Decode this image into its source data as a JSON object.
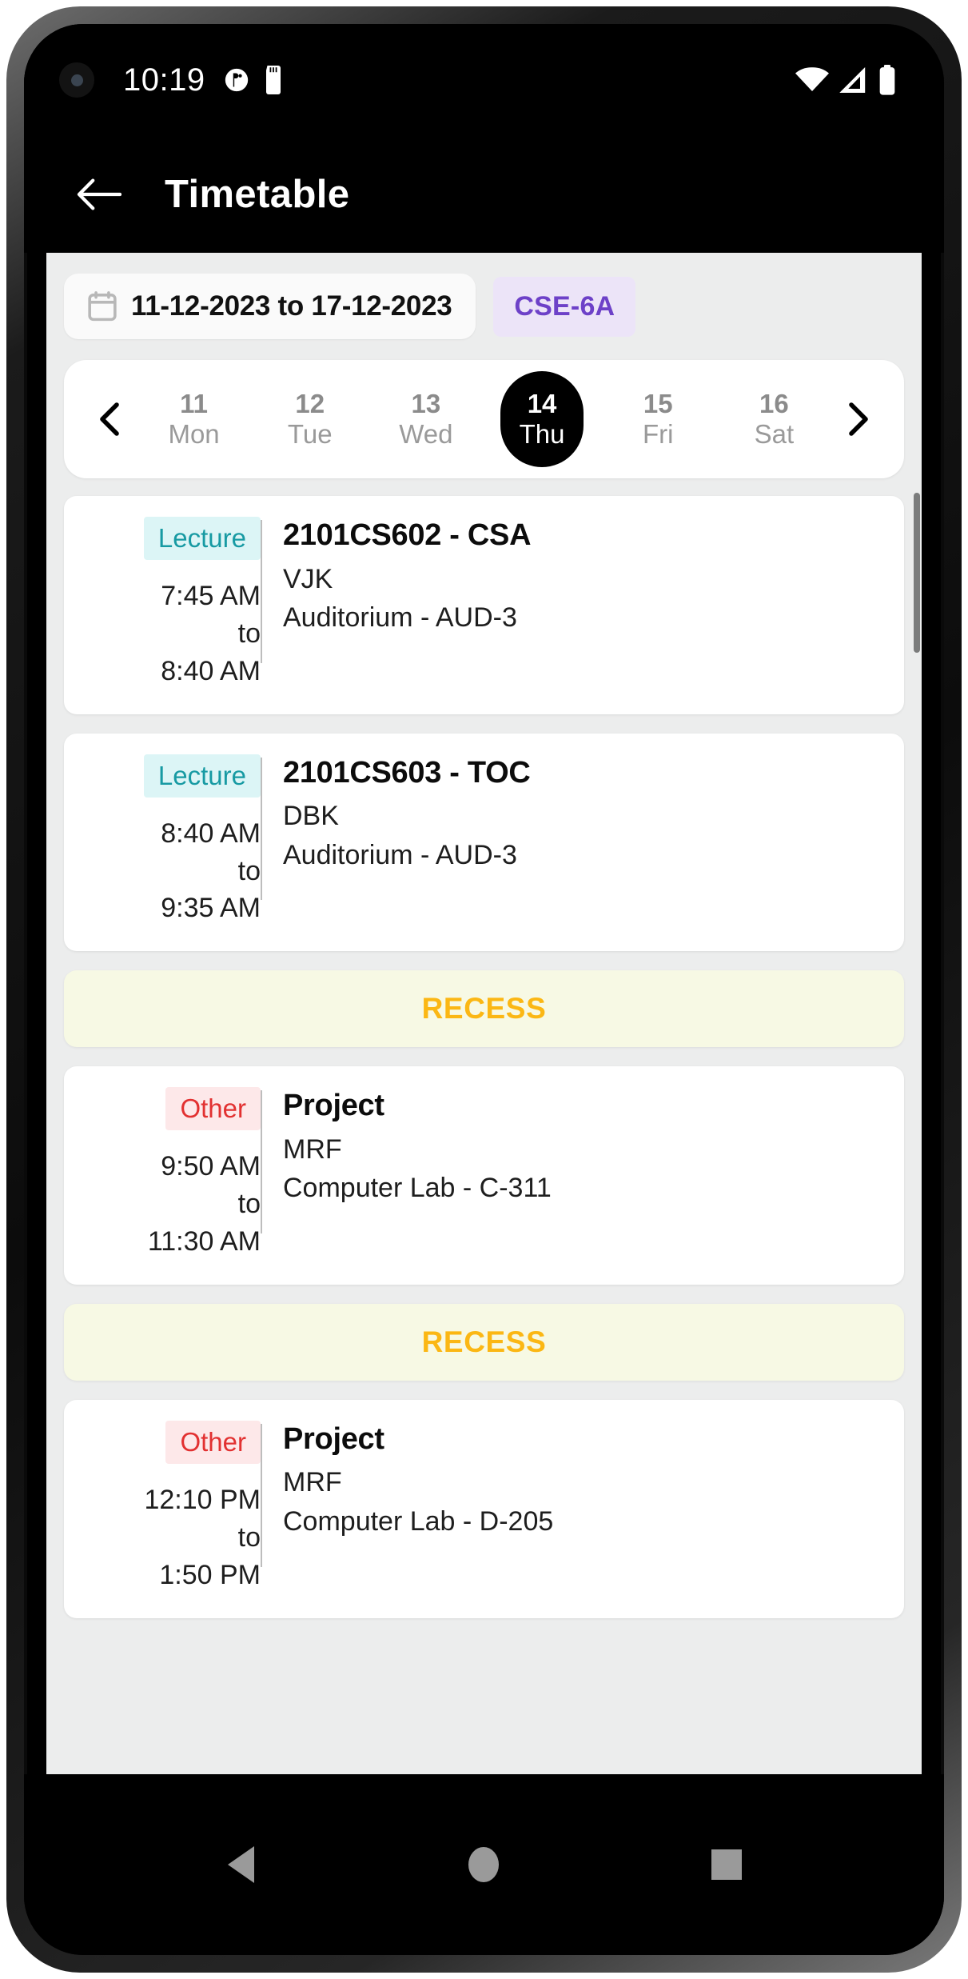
{
  "status_bar": {
    "time": "10:19",
    "left_icons": [
      "camera-punch-hole",
      "app-notification-icon",
      "sd-card-icon"
    ],
    "right_icons": [
      "wifi-icon",
      "cellular-signal-icon",
      "battery-icon"
    ]
  },
  "app_bar": {
    "back_icon": "arrow-left-icon",
    "title": "Timetable"
  },
  "filters": {
    "calendar_icon": "calendar-icon",
    "date_range": "11-12-2023 to 17-12-2023",
    "class": "CSE-6A",
    "class_accent_color": "#6d41c8",
    "class_bg_color": "#ece4f8"
  },
  "day_strip": {
    "prev_icon": "chevron-left-icon",
    "next_icon": "chevron-right-icon",
    "days": [
      {
        "num": "11",
        "dow": "Mon",
        "selected": false
      },
      {
        "num": "12",
        "dow": "Tue",
        "selected": false
      },
      {
        "num": "13",
        "dow": "Wed",
        "selected": false
      },
      {
        "num": "14",
        "dow": "Thu",
        "selected": true
      },
      {
        "num": "15",
        "dow": "Fri",
        "selected": false
      },
      {
        "num": "16",
        "dow": "Sat",
        "selected": false
      }
    ]
  },
  "schedule": [
    {
      "kind": "session",
      "badge": "Lecture",
      "badge_style": "lecture",
      "badge_color": "#179aa3",
      "badge_bg": "#dcf5f6",
      "start": "7:45 AM",
      "separator": "to",
      "end": "8:40 AM",
      "subject": "2101CS602 - CSA",
      "faculty": "VJK",
      "room": "Auditorium - AUD-3"
    },
    {
      "kind": "session",
      "badge": "Lecture",
      "badge_style": "lecture",
      "badge_color": "#179aa3",
      "badge_bg": "#dcf5f6",
      "start": "8:40 AM",
      "separator": "to",
      "end": "9:35 AM",
      "subject": "2101CS603 - TOC",
      "faculty": "DBK",
      "room": "Auditorium - AUD-3"
    },
    {
      "kind": "recess",
      "label": "RECESS",
      "color": "#fbb714",
      "bg": "#f7f9e4"
    },
    {
      "kind": "session",
      "badge": "Other",
      "badge_style": "other",
      "badge_color": "#e23131",
      "badge_bg": "#fde8e9",
      "start": "9:50 AM",
      "separator": "to",
      "end": "11:30 AM",
      "subject": "Project",
      "faculty": "MRF",
      "room": "Computer Lab - C-311"
    },
    {
      "kind": "recess",
      "label": "RECESS",
      "color": "#fbb714",
      "bg": "#f7f9e4"
    },
    {
      "kind": "session",
      "badge": "Other",
      "badge_style": "other",
      "badge_color": "#e23131",
      "badge_bg": "#fde8e9",
      "start": "12:10 PM",
      "separator": "to",
      "end": "1:50 PM",
      "subject": "Project",
      "faculty": "MRF",
      "room": "Computer Lab - D-205"
    }
  ],
  "nav_bar": {
    "back": "triangle-back-icon",
    "home": "circle-home-icon",
    "recents": "square-recents-icon"
  }
}
